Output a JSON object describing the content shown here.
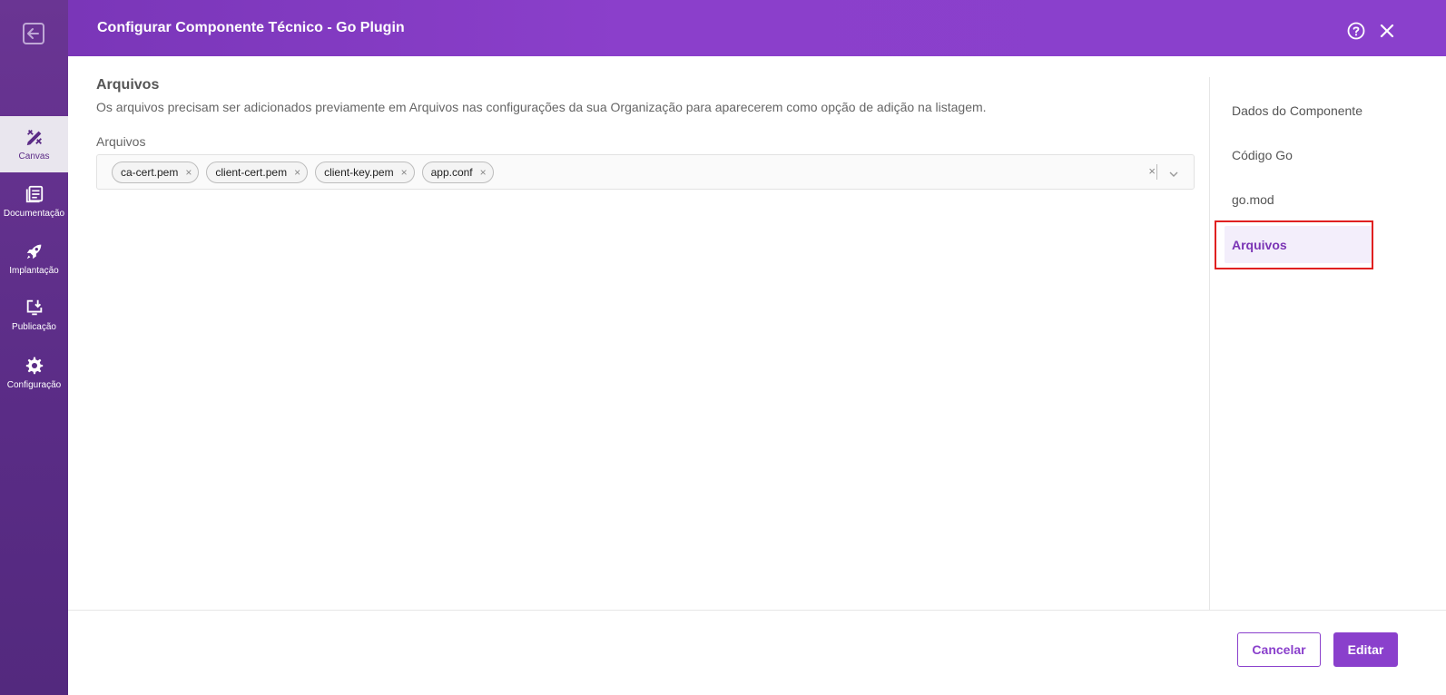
{
  "header": {
    "title": "Configurar Componente Técnico - Go Plugin"
  },
  "rail": {
    "items": [
      {
        "label": "Canvas",
        "icon": "canvas-tools-icon",
        "active": true
      },
      {
        "label": "Documentação",
        "icon": "documentation-icon",
        "active": false
      },
      {
        "label": "Implantação",
        "icon": "rocket-icon",
        "active": false
      },
      {
        "label": "Publicação",
        "icon": "publish-icon",
        "active": false
      },
      {
        "label": "Configuração",
        "icon": "gear-icon",
        "active": false
      }
    ]
  },
  "main": {
    "section_title": "Arquivos",
    "section_description": "Os arquivos precisam ser adicionados previamente em Arquivos nas configurações da sua Organização para aparecerem como opção de adição na listagem.",
    "field_label": "Arquivos",
    "selected_files": [
      "ca-cert.pem",
      "client-cert.pem",
      "client-key.pem",
      "app.conf"
    ],
    "chip_remove_glyph": "×",
    "clear_glyph": "×"
  },
  "right_nav": {
    "items": [
      {
        "label": "Dados do Componente",
        "active": false
      },
      {
        "label": "Código Go",
        "active": false
      },
      {
        "label": "go.mod",
        "active": false
      },
      {
        "label": "Arquivos",
        "active": true
      }
    ]
  },
  "footer": {
    "cancel_label": "Cancelar",
    "edit_label": "Editar"
  },
  "colors": {
    "accent": "#8a40cc",
    "rail": "#5a2c86",
    "highlight": "#e02020"
  }
}
